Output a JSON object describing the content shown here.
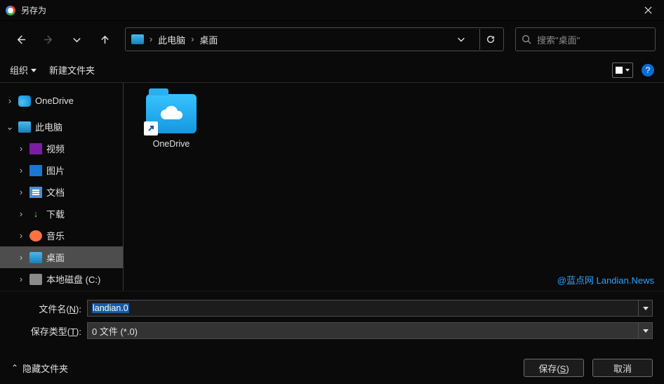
{
  "title": "另存为",
  "breadcrumb": {
    "item1": "此电脑",
    "item2": "桌面"
  },
  "search": {
    "placeholder": "搜索\"桌面\""
  },
  "cmdbar": {
    "organize": "组织",
    "newfolder": "新建文件夹"
  },
  "sidebar": {
    "onedrive": "OneDrive",
    "thispc": "此电脑",
    "videos": "视频",
    "pictures": "图片",
    "documents": "文档",
    "downloads": "下载",
    "music": "音乐",
    "desktop": "桌面",
    "localdisk": "本地磁盘 (C:)"
  },
  "files": {
    "item1": "OneDrive"
  },
  "watermark": "@蓝点网 Landian.News",
  "form": {
    "filename_label_pre": "文件名(",
    "filename_label_ul": "N",
    "filename_label_post": "):",
    "filename_value": "landian.0",
    "type_label_pre": "保存类型(",
    "type_label_ul": "T",
    "type_label_post": "):",
    "type_value": "0 文件 (*.0)"
  },
  "footer": {
    "hide_folders": "隐藏文件夹",
    "save_pre": "保存(",
    "save_ul": "S",
    "save_post": ")",
    "cancel": "取消"
  }
}
